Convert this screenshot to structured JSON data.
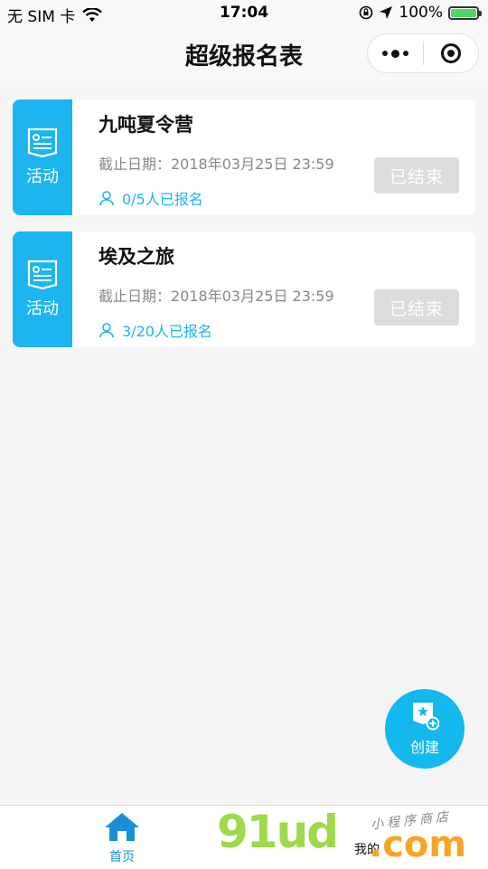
{
  "status_bar": {
    "carrier": "无 SIM 卡",
    "time": "17:04",
    "battery": "100%",
    "battery_level": 1.0
  },
  "nav": {
    "title": "超级报名表"
  },
  "cards": [
    {
      "side_label": "活动",
      "title": "九吨夏令营",
      "deadline": "截止日期：2018年03月25日 23:59",
      "count": "0/5人已报名",
      "status": "已结束"
    },
    {
      "side_label": "活动",
      "title": "埃及之旅",
      "deadline": "截止日期：2018年03月25日 23:59",
      "count": "3/20人已报名",
      "status": "已结束"
    }
  ],
  "fab": {
    "label": "创建"
  },
  "tab_bar": {
    "home_label": "首页",
    "mine_label": "我的"
  },
  "watermark": {
    "big": "91ud",
    "com": ".com",
    "small": "小程序商店"
  },
  "colors": {
    "accent": "#1cb5f0",
    "ended": "#dcdcdc",
    "battery": "#4cd964"
  }
}
